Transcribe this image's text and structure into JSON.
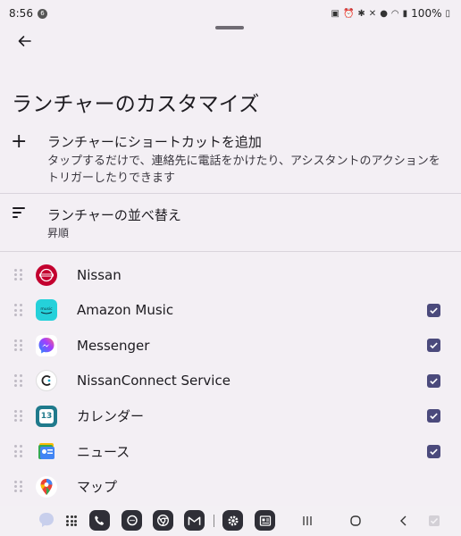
{
  "status_bar": {
    "time": "8:56",
    "notification_badge": "6",
    "battery": "100%"
  },
  "header": {
    "title": "ランチャーのカスタマイズ"
  },
  "add_shortcut": {
    "title": "ランチャーにショートカットを追加",
    "description": "タップするだけで、連絡先に電話をかけたり、アシスタントのアクションをトリガーしたりできます"
  },
  "sort": {
    "title": "ランチャーの並べ替え",
    "value": "昇順"
  },
  "apps": [
    {
      "name": "Nissan",
      "icon": "nissan-icon",
      "checked": null
    },
    {
      "name": "Amazon Music",
      "icon": "amazon-music-icon",
      "checked": true
    },
    {
      "name": "Messenger",
      "icon": "messenger-icon",
      "checked": true
    },
    {
      "name": "NissanConnect Service",
      "icon": "nissanconnect-icon",
      "checked": true
    },
    {
      "name": "カレンダー",
      "icon": "calendar-icon",
      "checked": true,
      "icon_text": "13"
    },
    {
      "name": "ニュース",
      "icon": "news-icon",
      "checked": true
    },
    {
      "name": "マップ",
      "icon": "maps-icon",
      "checked": null
    }
  ],
  "colors": {
    "background": "#f3eff4",
    "checkbox": "#4b4a7c",
    "nissan_red": "#c3002f"
  }
}
